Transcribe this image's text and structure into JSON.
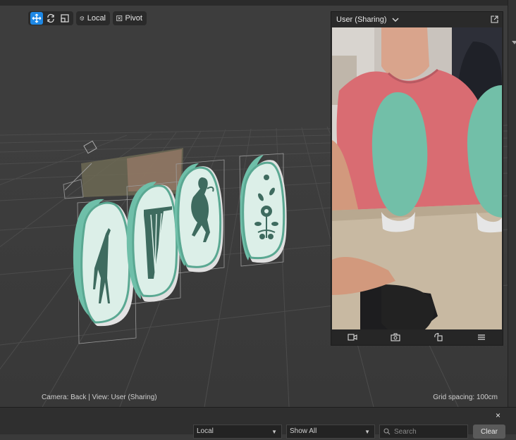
{
  "toolbar": {
    "coordinate_space_label": "Local",
    "pivot_label": "Pivot",
    "active_tool": "move"
  },
  "overlay": {
    "title": "User (Sharing)"
  },
  "status": {
    "camera_view": "Camera: Back | View: User (Sharing)",
    "grid_spacing": "Grid spacing: 100cm"
  },
  "bottom_panel": {
    "close_label": "×",
    "scope_dropdown": "Local",
    "filter_dropdown": "Show All",
    "search_placeholder": "Search",
    "clear_label": "Clear"
  },
  "nails": [
    {
      "name": "giraffe-nail",
      "motif": "giraffe"
    },
    {
      "name": "zebra-nail",
      "motif": "zebra"
    },
    {
      "name": "cat-nail",
      "motif": "leaping cat"
    },
    {
      "name": "flower-nail",
      "motif": "flowers"
    }
  ],
  "colors": {
    "accent": "#1e88e5",
    "nail_teal": "#6fbfa9",
    "nail_face": "#dcefe8",
    "motif": "#3e6b5f",
    "viewport_bg": "#3d3d3d"
  }
}
